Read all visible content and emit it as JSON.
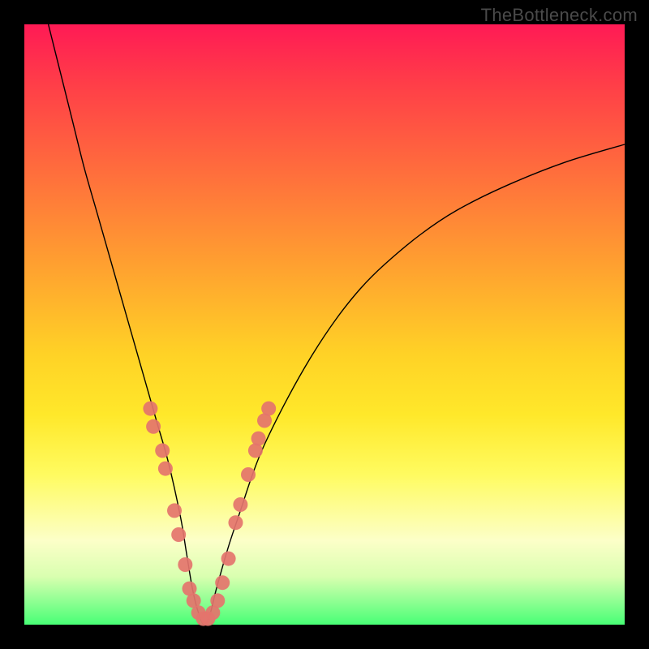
{
  "watermark": "TheBottleneck.com",
  "colors": {
    "frame_bg_top": "#ff1a55",
    "frame_bg_bottom": "#48ff76",
    "curve": "#000000",
    "marker": "#e4746d",
    "page_bg": "#000000"
  },
  "chart_data": {
    "type": "line",
    "title": "",
    "xlabel": "",
    "ylabel": "",
    "xlim": [
      0,
      100
    ],
    "ylim": [
      0,
      100
    ],
    "grid": false,
    "legend": false,
    "series": [
      {
        "name": "bottleneck-curve",
        "x": [
          4,
          6,
          8,
          10,
          12,
          14,
          16,
          18,
          20,
          22,
          24,
          26,
          27,
          28,
          29,
          30,
          31,
          32,
          34,
          36,
          38,
          40,
          44,
          48,
          52,
          56,
          60,
          66,
          72,
          80,
          90,
          100
        ],
        "values": [
          100,
          92,
          84,
          76,
          69,
          62,
          55,
          48,
          41,
          34,
          27,
          18,
          12,
          6,
          2,
          0,
          2,
          6,
          13,
          19,
          25,
          30,
          38,
          45,
          51,
          56,
          60,
          65,
          69,
          73,
          77,
          80
        ]
      }
    ],
    "markers": [
      {
        "x": 21.0,
        "y": 36
      },
      {
        "x": 21.5,
        "y": 33
      },
      {
        "x": 23.0,
        "y": 29
      },
      {
        "x": 23.5,
        "y": 26
      },
      {
        "x": 25.0,
        "y": 19
      },
      {
        "x": 25.7,
        "y": 15
      },
      {
        "x": 26.8,
        "y": 10
      },
      {
        "x": 27.5,
        "y": 6
      },
      {
        "x": 28.2,
        "y": 4
      },
      {
        "x": 29.0,
        "y": 2
      },
      {
        "x": 29.8,
        "y": 1
      },
      {
        "x": 30.6,
        "y": 1
      },
      {
        "x": 31.4,
        "y": 2
      },
      {
        "x": 32.2,
        "y": 4
      },
      {
        "x": 33.0,
        "y": 7
      },
      {
        "x": 34.0,
        "y": 11
      },
      {
        "x": 35.2,
        "y": 17
      },
      {
        "x": 36.0,
        "y": 20
      },
      {
        "x": 37.3,
        "y": 25
      },
      {
        "x": 38.5,
        "y": 29
      },
      {
        "x": 39.0,
        "y": 31
      },
      {
        "x": 40.0,
        "y": 34
      },
      {
        "x": 40.7,
        "y": 36
      }
    ],
    "marker_radius_px": 9
  }
}
